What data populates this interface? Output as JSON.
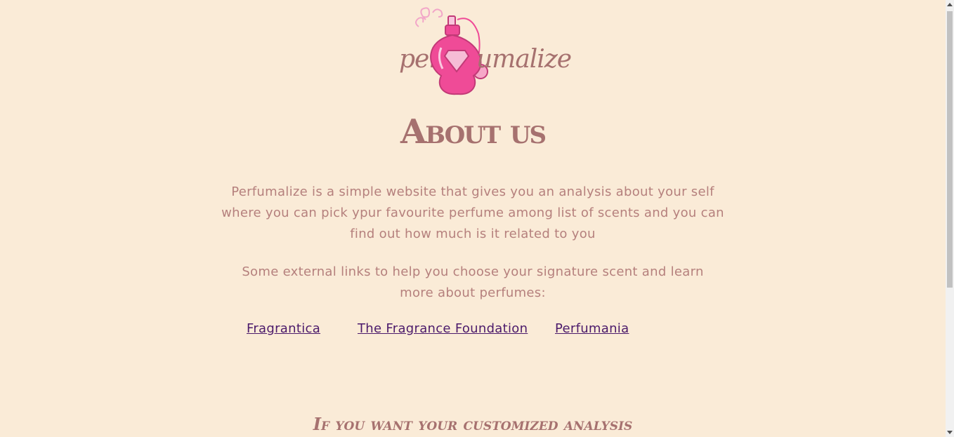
{
  "logo": {
    "text_left": "per",
    "text_right": "umalize"
  },
  "page_title": "About us",
  "intro_paragraph": "Perfumalize is a simple website that gives you an analysis about your self where you can pick ypur favourite perfume among list of scents and you can find out how much is it related to you",
  "links_paragraph": "Some external links to help you choose your signature scent and learn more about perfumes:",
  "links": [
    {
      "label": "Fragrantica"
    },
    {
      "label": "The Fragrance Foundation"
    },
    {
      "label": "Perfumania"
    }
  ],
  "cta_heading": "If you want your customized analysis",
  "colors": {
    "background": "#faebd7",
    "text": "#a6716f",
    "link": "#4b1a6b",
    "bottle_pink": "#ef4b97"
  }
}
